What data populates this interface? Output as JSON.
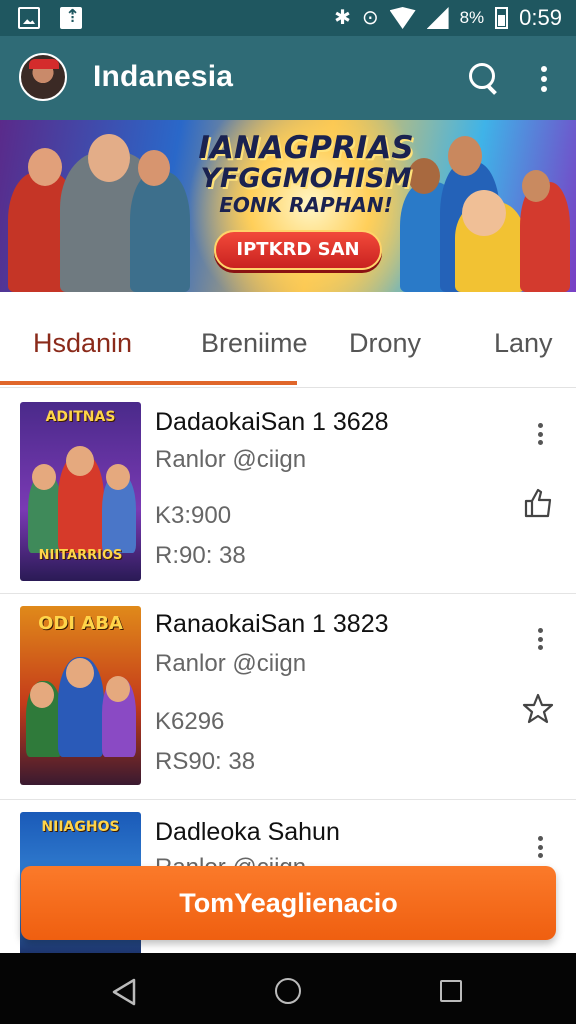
{
  "status_bar": {
    "left_icons": [
      "image-icon",
      "download-icon"
    ],
    "right_icons": [
      "bluetooth-icon",
      "alarm-icon",
      "wifi-icon",
      "signal-icon",
      "battery-icon"
    ],
    "battery_percent": "8%",
    "time": "0:59"
  },
  "app_bar": {
    "title": "Indanesia",
    "background": "#2f6b76"
  },
  "banner": {
    "line1": "IANAGPRIAS",
    "line2": "YFGGMOHISM",
    "line3": "EONK RAPHAN!",
    "cta": "IPTKRD SAN"
  },
  "tabs": [
    {
      "label": "Hsdanin",
      "active": true
    },
    {
      "label": "Breniime",
      "active": false
    },
    {
      "label": "Drony",
      "active": false
    },
    {
      "label": "Lany",
      "active": false
    }
  ],
  "items": [
    {
      "title": "DadaokaiSan 1 3628",
      "subtitle": "Ranlor @ciign",
      "line3": "K3:900",
      "line4": "R:90: 38",
      "thumb_title": "ADITNAS",
      "thumb_footer": "NIITARRIOS"
    },
    {
      "title": "RanaokaiSan 1 3823",
      "subtitle": "Ranlor @ciign",
      "line3": "K6296",
      "line4": "RS90: 38",
      "thumb_title": "ODI ABA",
      "thumb_footer": ""
    },
    {
      "title": "Dadleoka Sahun",
      "subtitle": "Ranlor @ciign",
      "thumb_title": "NIIAGHOS",
      "thumb_footer": ""
    }
  ],
  "action_button": {
    "label": "TomYeaglienacio",
    "color": "#f36b1c"
  },
  "nav_bar": {
    "icons": [
      "back-icon",
      "home-icon",
      "recents-icon"
    ]
  }
}
